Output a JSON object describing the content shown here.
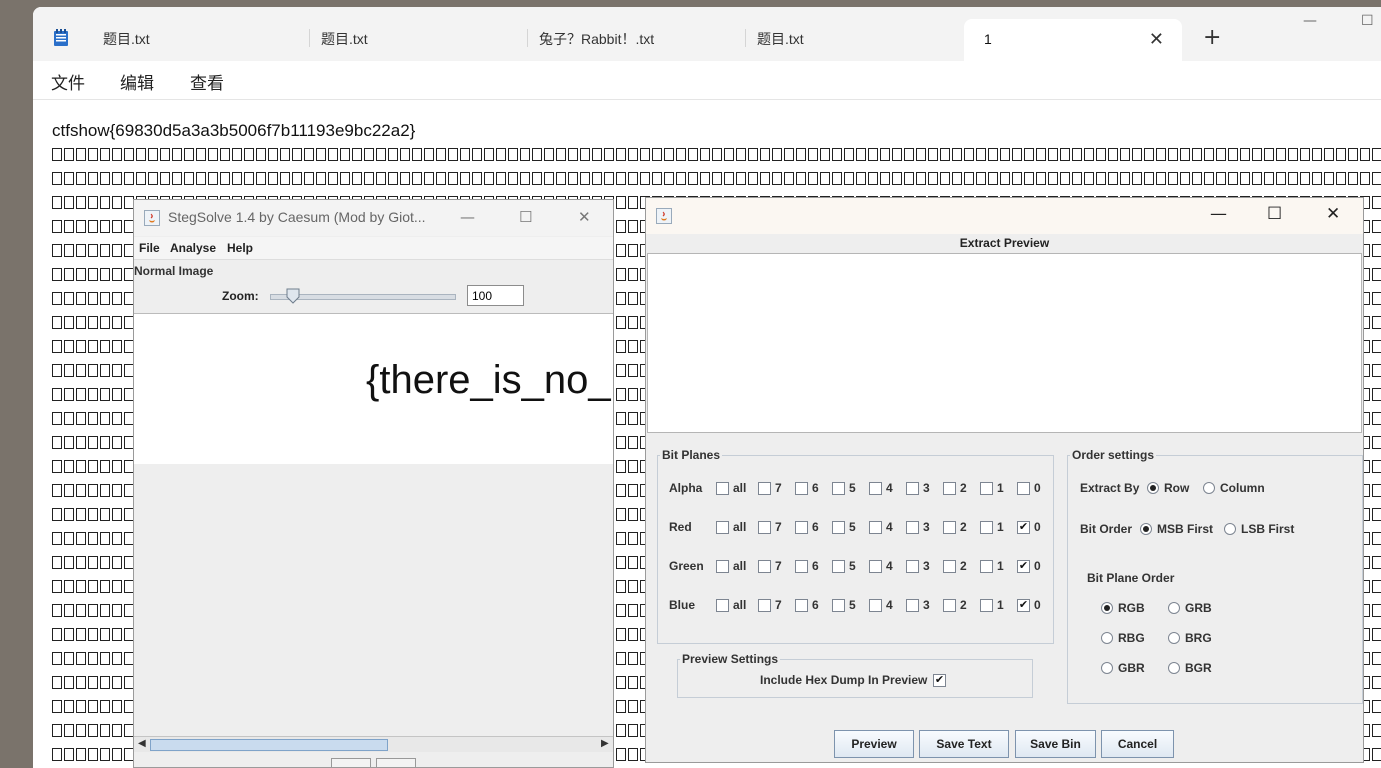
{
  "notepad": {
    "tabs": [
      {
        "label": "题目.txt"
      },
      {
        "label": "题目.txt"
      },
      {
        "label": "兔子？Rabbit！.txt"
      },
      {
        "label": "题目.txt"
      },
      {
        "label": "1"
      }
    ],
    "new_tab": "+",
    "close_tab": "✕",
    "menu": [
      "文件",
      "编辑",
      "查看"
    ],
    "content_first_line": "ctfshow{69830d5a3a3b5006f7b11193e9bc22a2}"
  },
  "stegsolve": {
    "title": "StegSolve 1.4 by Caesum (Mod by Giot...",
    "menu": [
      "File",
      "Analyse",
      "Help"
    ],
    "image_label": "Normal Image",
    "zoom_label": "Zoom:",
    "zoom_value": "100",
    "zoom_slider_fraction": 0.1,
    "canvas_text": "{there_is_no_"
  },
  "extract": {
    "header": "Extract Preview",
    "bit_planes": {
      "title": "Bit Planes",
      "rows": [
        {
          "name": "Alpha",
          "checked": []
        },
        {
          "name": "Red",
          "checked": [
            "0"
          ]
        },
        {
          "name": "Green",
          "checked": [
            "0"
          ]
        },
        {
          "name": "Blue",
          "checked": [
            "0"
          ]
        }
      ],
      "columns": [
        "all",
        "7",
        "6",
        "5",
        "4",
        "3",
        "2",
        "1",
        "0"
      ]
    },
    "order": {
      "title": "Order settings",
      "extract_by_label": "Extract By",
      "row": "Row",
      "column": "Column",
      "bit_order_label": "Bit Order",
      "msb": "MSB First",
      "lsb": "LSB First",
      "plane_order_label": "Bit Plane Order",
      "plane_options": [
        "RGB",
        "GRB",
        "RBG",
        "BRG",
        "GBR",
        "BGR"
      ],
      "plane_selected": "RGB",
      "extract_by_selected": "Row",
      "bit_order_selected": "MSB First"
    },
    "preview_settings": {
      "title": "Preview Settings",
      "hex_dump": "Include Hex Dump In Preview",
      "hex_dump_checked": true
    },
    "buttons": {
      "preview": "Preview",
      "save_text": "Save Text",
      "save_bin": "Save Bin",
      "cancel": "Cancel"
    }
  }
}
